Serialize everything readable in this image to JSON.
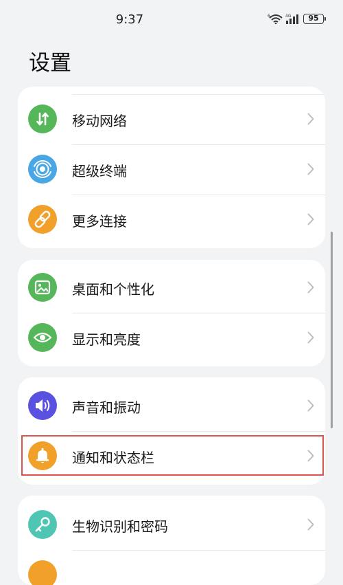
{
  "status_bar": {
    "time": "9:37",
    "wifi_badge": "6",
    "signal_badge": "4G",
    "battery": "95"
  },
  "page": {
    "title": "设置"
  },
  "colors": {
    "green": "#56b75a",
    "blue": "#48a7e4",
    "orange": "#f1a02a",
    "purple": "#5b51e0",
    "teal": "#4fc6b4",
    "highlight": "#d9534f"
  },
  "groups": [
    {
      "items": [
        {
          "label": "移动网络",
          "icon": "mobile-data-icon",
          "color": "green"
        },
        {
          "label": "超级终端",
          "icon": "super-device-icon",
          "color": "blue"
        },
        {
          "label": "更多连接",
          "icon": "link-icon",
          "color": "orange"
        }
      ]
    },
    {
      "items": [
        {
          "label": "桌面和个性化",
          "icon": "wallpaper-icon",
          "color": "green"
        },
        {
          "label": "显示和亮度",
          "icon": "eye-icon",
          "color": "green"
        }
      ]
    },
    {
      "items": [
        {
          "label": "声音和振动",
          "icon": "speaker-icon",
          "color": "purple"
        },
        {
          "label": "通知和状态栏",
          "icon": "bell-icon",
          "color": "orange",
          "highlighted": true
        }
      ]
    },
    {
      "items": [
        {
          "label": "生物识别和密码",
          "icon": "key-icon",
          "color": "teal"
        }
      ]
    }
  ]
}
